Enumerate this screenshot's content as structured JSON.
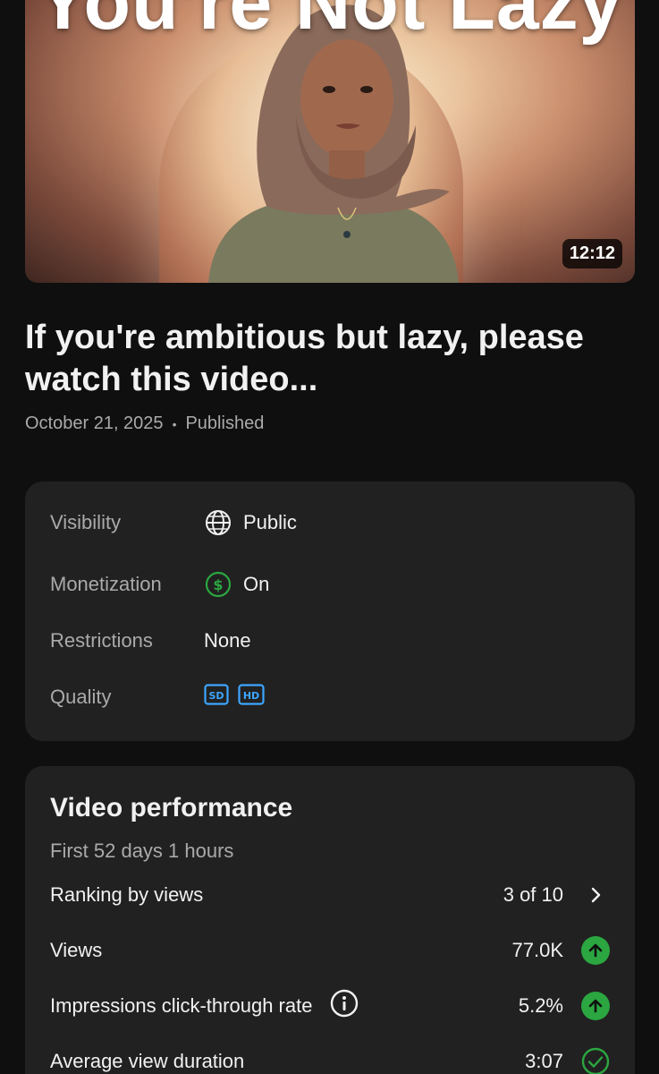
{
  "thumbnail": {
    "overlay_text": "You're Not Lazy",
    "duration": "12:12"
  },
  "video": {
    "title": "If you're ambitious but lazy, please watch this video...",
    "date": "October 21, 2025",
    "separator": "•",
    "status": "Published"
  },
  "details": {
    "visibility": {
      "label": "Visibility",
      "value": "Public",
      "icon": "globe-icon"
    },
    "monetization": {
      "label": "Monetization",
      "value": "On",
      "icon": "dollar-circle-icon",
      "color": "#2ba640"
    },
    "restrictions": {
      "label": "Restrictions",
      "value": "None"
    },
    "quality": {
      "label": "Quality",
      "badges": [
        "SD",
        "HD"
      ],
      "color": "#3ea6ff"
    }
  },
  "performance": {
    "title": "Video performance",
    "subtitle": "First 52 days 1 hours",
    "ranking": {
      "label": "Ranking by views",
      "value": "3 of 10",
      "icon": "chevron-right-icon"
    },
    "views": {
      "label": "Views",
      "value": "77.0K",
      "trend": "up",
      "color": "#2ba640"
    },
    "ctr": {
      "label": "Impressions click-through rate",
      "value": "5.2%",
      "trend": "up",
      "color": "#2ba640",
      "info_icon": "info-icon"
    },
    "avd": {
      "label": "Average view duration",
      "value": "3:07",
      "trend": "typical",
      "color": "#2ba640"
    }
  }
}
